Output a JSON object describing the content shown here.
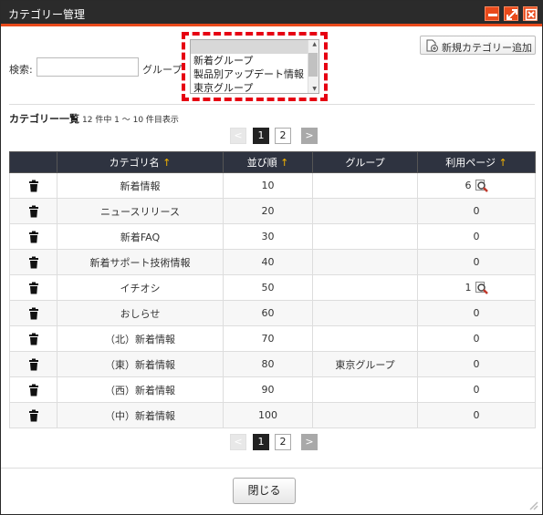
{
  "window": {
    "title": "カテゴリー管理"
  },
  "search": {
    "label": "検索:",
    "value": "",
    "placeholder": ""
  },
  "group_filter": {
    "label": "グループ",
    "options": [
      "",
      "新着グループ",
      "製品別アップデート情報",
      "東京グループ"
    ]
  },
  "new_category_button": "新規カテゴリー追加",
  "list": {
    "title": "カテゴリー一覧",
    "count_text": "12 件中 1 ～ 10 件目表示"
  },
  "pagination": {
    "prev": "<",
    "pages": [
      "1",
      "2"
    ],
    "current": "1",
    "next": ">"
  },
  "table": {
    "headers": [
      "カテゴリ名",
      "並び順",
      "グループ",
      "利用ページ"
    ],
    "sort_indicator": "↑",
    "rows": [
      {
        "name": "新着情報",
        "order": "10",
        "group": "",
        "usage": "6"
      },
      {
        "name": "ニュースリリース",
        "order": "20",
        "group": "",
        "usage": "0"
      },
      {
        "name": "新着FAQ",
        "order": "30",
        "group": "",
        "usage": "0"
      },
      {
        "name": "新着サポート技術情報",
        "order": "40",
        "group": "",
        "usage": "0"
      },
      {
        "name": "イチオシ",
        "order": "50",
        "group": "",
        "usage": "1"
      },
      {
        "name": "おしらせ",
        "order": "60",
        "group": "",
        "usage": "0"
      },
      {
        "name": "（北）新着情報",
        "order": "70",
        "group": "",
        "usage": "0"
      },
      {
        "name": "（東）新着情報",
        "order": "80",
        "group": "東京グループ",
        "usage": "0"
      },
      {
        "name": "（西）新着情報",
        "order": "90",
        "group": "",
        "usage": "0"
      },
      {
        "name": "（中）新着情報",
        "order": "100",
        "group": "",
        "usage": "0"
      }
    ]
  },
  "close_button": "閉じる",
  "colors": {
    "accent": "#e94a1b",
    "header_bg": "#2e3340",
    "highlight": "#e60012",
    "sort_arrow": "#f5b400"
  }
}
